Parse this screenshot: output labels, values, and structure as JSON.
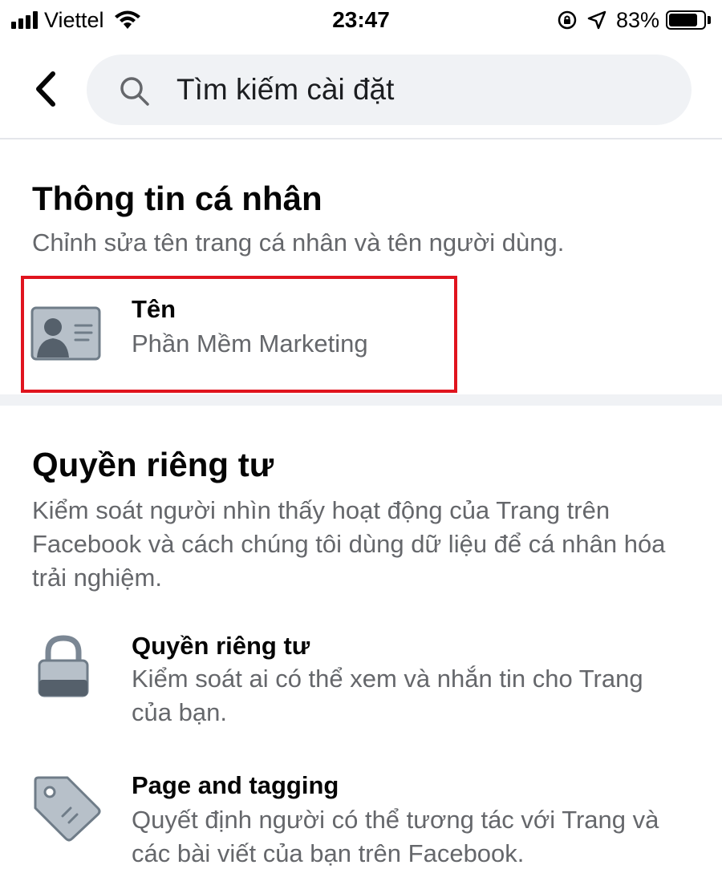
{
  "status_bar": {
    "carrier": "Viettel",
    "time": "23:47",
    "battery": "83%",
    "battery_level": 0.83,
    "icons": [
      "signal-icon",
      "wifi-icon",
      "rotation-lock-icon",
      "location-icon",
      "battery-icon"
    ]
  },
  "header": {
    "back_icon": "chevron-left-icon",
    "search_icon": "search-icon",
    "search_placeholder": "Tìm kiếm cài đặt",
    "search_value": ""
  },
  "personal_info": {
    "title": "Thông tin cá nhân",
    "description": "Chỉnh sửa tên trang cá nhân và tên người dùng.",
    "items": [
      {
        "icon": "id-card-icon",
        "title": "Tên",
        "subtitle": "Phần Mềm Marketing"
      }
    ]
  },
  "privacy": {
    "title": "Quyền riêng tư",
    "description": "Kiểm soát người nhìn thấy hoạt động của Trang trên Facebook và cách chúng tôi dùng dữ liệu để cá nhân hóa trải nghiệm.",
    "items": [
      {
        "icon": "lock-icon",
        "title": "Quyền riêng tư",
        "subtitle": "Kiểm soát ai có thể xem và nhắn tin cho Trang của bạn."
      },
      {
        "icon": "tag-icon",
        "title": "Page and tagging",
        "subtitle": "Quyết định người có thể tương tác với Trang và các bài viết của bạn trên Facebook."
      }
    ]
  },
  "colors": {
    "highlight": "#e0141e",
    "text_primary": "#050505",
    "text_secondary": "#65676b",
    "search_bg": "#f0f2f5",
    "icon_gray": "#7b8794"
  }
}
